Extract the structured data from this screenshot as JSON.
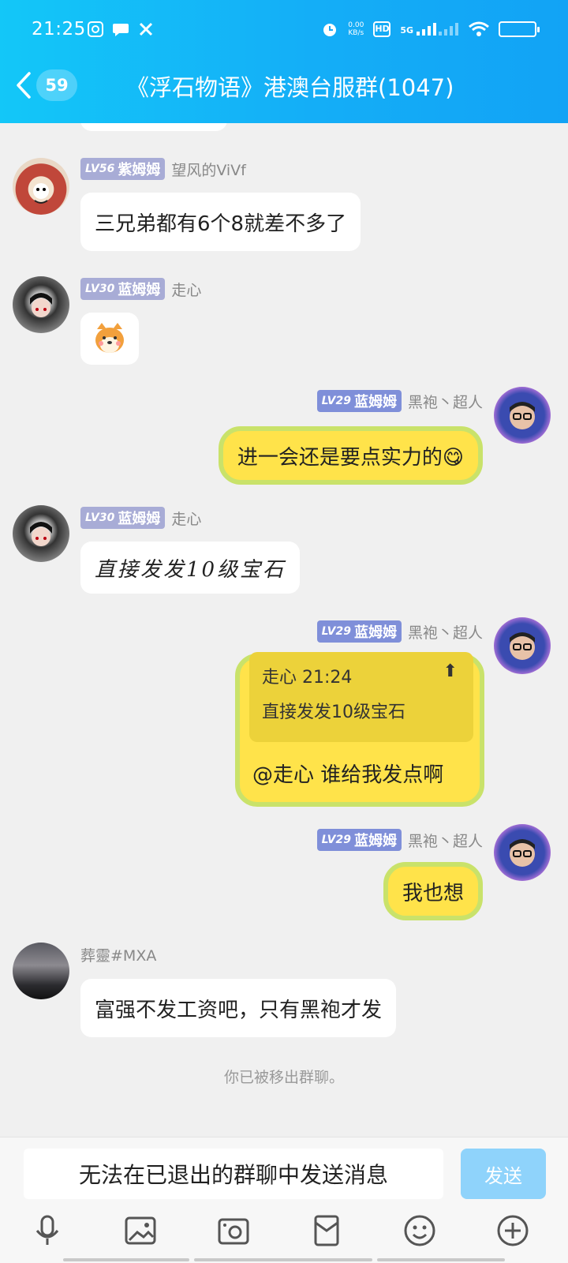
{
  "status_bar": {
    "time": "21:25",
    "speed_value": "0.00",
    "speed_unit": "KB/s",
    "network": "5G",
    "hd": "HD"
  },
  "header": {
    "back_count": "59",
    "title": "《浮石物语》港澳台服群(1047)"
  },
  "messages": [
    {
      "level": "LV56",
      "title": "紫姆姆",
      "name": "望风的ViVf",
      "text": "三兄弟都有6个8就差不多了"
    },
    {
      "level": "LV30",
      "title": "蓝姆姆",
      "name": "走心",
      "text": "",
      "sticker": "shiba-sticker"
    },
    {
      "level": "LV29",
      "title": "蓝姆姆",
      "name": "黑袍丶超人",
      "text": "进一会还是要点实力的😋"
    },
    {
      "level": "LV30",
      "title": "蓝姆姆",
      "name": "走心",
      "text": "直接发发10级宝石"
    },
    {
      "level": "LV29",
      "title": "蓝姆姆",
      "name": "黑袍丶超人",
      "quote_header": "走心 21:24",
      "quote_text": "直接发发10级宝石",
      "text": "@走心 谁给我发点啊"
    },
    {
      "level": "LV29",
      "title": "蓝姆姆",
      "name": "黑袍丶超人",
      "text": "我也想"
    },
    {
      "level": "",
      "title": "",
      "name": "葬靈#MXA",
      "text": "富强不发工资吧，只有黑袍才发"
    }
  ],
  "system_note": "你已被移出群聊。",
  "composer": {
    "input_text": "无法在已退出的群聊中发送消息",
    "send_label": "发送"
  },
  "toolbar": [
    "microphone-icon",
    "photo-icon",
    "camera-icon",
    "red-packet-icon",
    "emoji-icon",
    "plus-icon"
  ],
  "colors": {
    "header_start": "#13c7f8",
    "header_end": "#12a3f5",
    "bubble_yellow": "#ffe34a",
    "bubble_border": "#c9e26a",
    "send_button": "#8fd3fb"
  }
}
